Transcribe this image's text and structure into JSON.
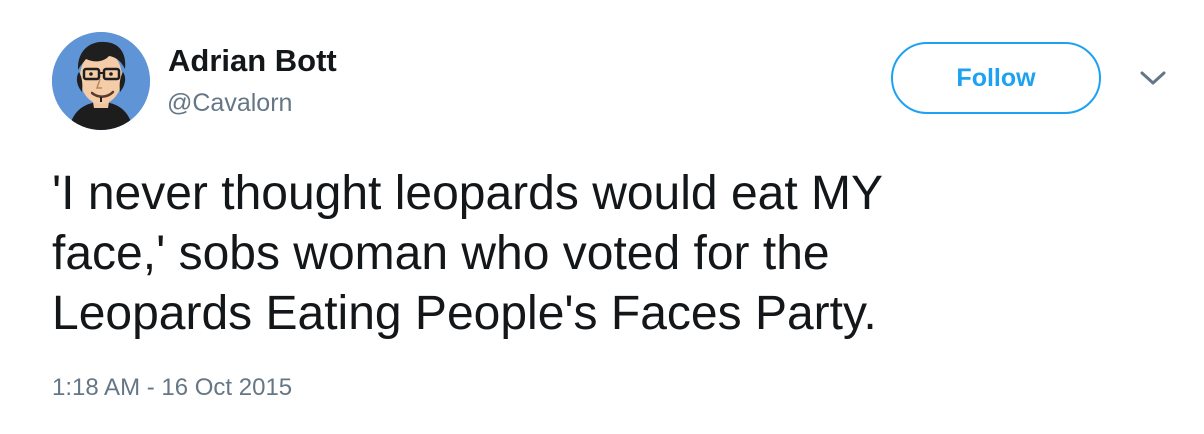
{
  "author": {
    "name": "Adrian Bott",
    "handle": "@Cavalorn",
    "avatar_icon": "cartoon-man-with-glasses-avatar"
  },
  "actions": {
    "follow_label": "Follow",
    "more_icon": "chevron-down-icon"
  },
  "tweet": {
    "lines": [
      "'I never thought leopards would eat MY",
      "face,' sobs woman who voted for the",
      "Leopards Eating People's Faces Party."
    ],
    "timestamp": "1:18 AM - 16 Oct 2015"
  },
  "colors": {
    "accent": "#1da1f2",
    "primary_text": "#14171a",
    "secondary_text": "#657786",
    "background": "#ffffff"
  }
}
